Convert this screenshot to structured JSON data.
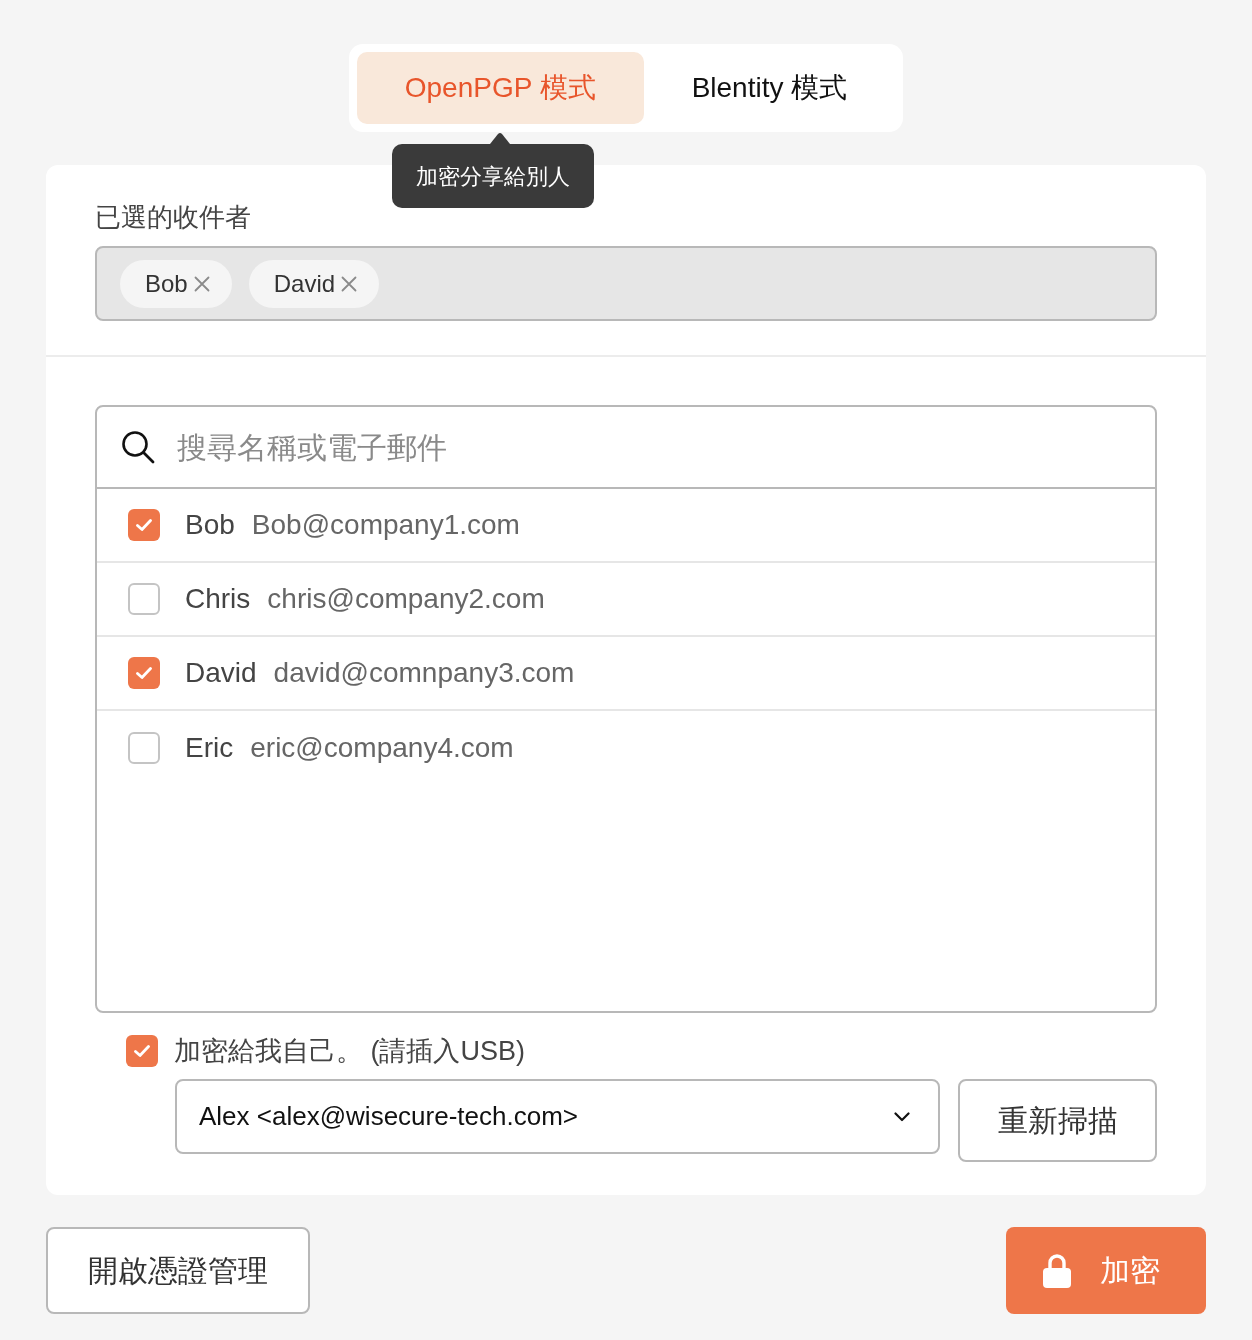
{
  "mode_tabs": [
    {
      "label": "OpenPGP 模式",
      "selected": true
    },
    {
      "label": "Blentity 模式",
      "selected": false
    }
  ],
  "tooltip": {
    "text": "加密分享給別人"
  },
  "selected_recipients": {
    "label": "已選的收件者",
    "chips": [
      {
        "name": "Bob"
      },
      {
        "name": "David"
      }
    ]
  },
  "recipient_list": {
    "search": {
      "placeholder": "搜尋名稱或電子郵件"
    },
    "rows": [
      {
        "name": "Bob",
        "email": "Bob@company1.com",
        "checked": true
      },
      {
        "name": "Chris",
        "email": "chris@company2.com",
        "checked": false
      },
      {
        "name": "David",
        "email": "david@comnpany3.com",
        "checked": true
      },
      {
        "name": "Eric",
        "email": "eric@company4.com",
        "checked": false
      }
    ]
  },
  "encrypt_to_self": {
    "label": "加密給我自己。 (請插入USB)",
    "checked": true,
    "key_select": {
      "value": "Alex <alex@wisecure-tech.com>"
    },
    "rescan_button": "重新掃描"
  },
  "footer": {
    "manage_button": "開啟憑證管理",
    "encrypt_button": "加密"
  }
}
